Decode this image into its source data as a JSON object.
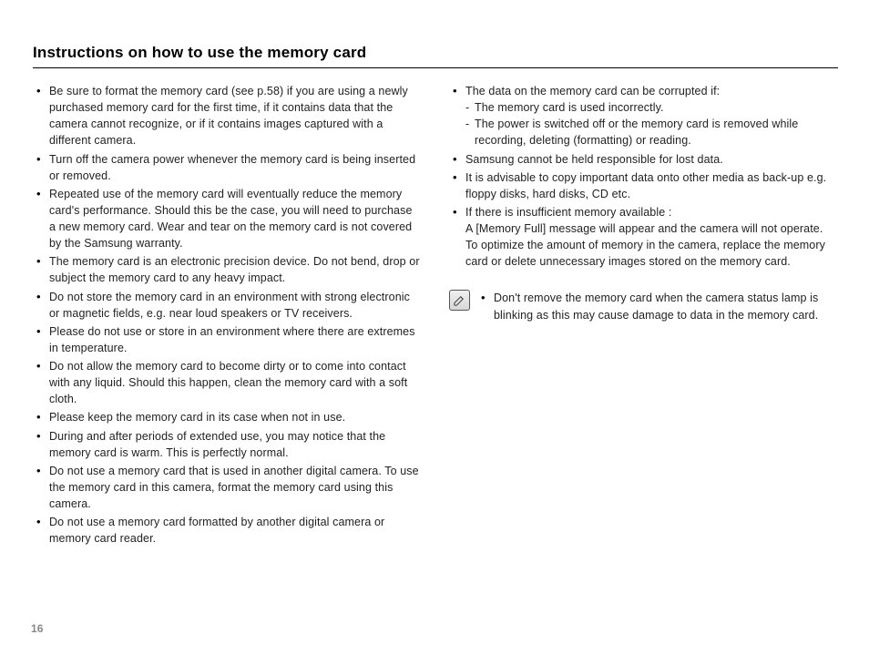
{
  "title": "Instructions on how to use the memory card",
  "page_number": "16",
  "left_bullets": [
    "Be sure to format the memory card (see p.58) if you are using a newly purchased memory card for the first time, if it contains data that the camera cannot recognize, or if it contains images captured with a different camera.",
    "Turn off the camera power whenever the memory card is being inserted or removed.",
    "Repeated use of the memory card will eventually reduce the memory card's performance. Should this be the case, you will need to purchase a new memory card. Wear and tear on the memory card is not covered by the Samsung warranty.",
    "The memory card is an electronic precision device. Do not bend, drop or subject the memory card to any heavy impact.",
    "Do not store the memory card in an environment with strong electronic or magnetic fields, e.g. near loud speakers or TV receivers.",
    "Please do not use or store in an environment where there are extremes in temperature.",
    "Do not allow the memory card to become dirty or to come into contact with any liquid. Should this happen, clean the memory card with a soft cloth.",
    "Please keep the memory card in its case when not in use.",
    "During and after periods of extended use, you may notice that the memory card is warm. This is perfectly normal.",
    "Do not use a memory card that is used in another digital camera. To use the memory card in this camera, format the memory card using this camera.",
    "Do not use a memory card formatted by another digital camera or memory card reader."
  ],
  "right_bullets": [
    {
      "text": "The data on the memory card can be corrupted if:",
      "sub": [
        "The memory card is used incorrectly.",
        "The power is switched off or the memory card is removed while recording, deleting (formatting) or reading."
      ]
    },
    {
      "text": "Samsung cannot be held responsible for lost data."
    },
    {
      "text": "It is advisable to copy important data onto other media as back-up e.g. floppy disks, hard disks, CD etc."
    },
    {
      "text": "If there is insufficient memory available :",
      "cont": "A [Memory Full] message will appear and the camera will not operate. To optimize the amount of memory in the camera, replace the memory card or delete unnecessary images stored on the memory card."
    }
  ],
  "note_bullet": "Don't remove the memory card when the camera status lamp is blinking as this may cause damage to data in the memory card."
}
